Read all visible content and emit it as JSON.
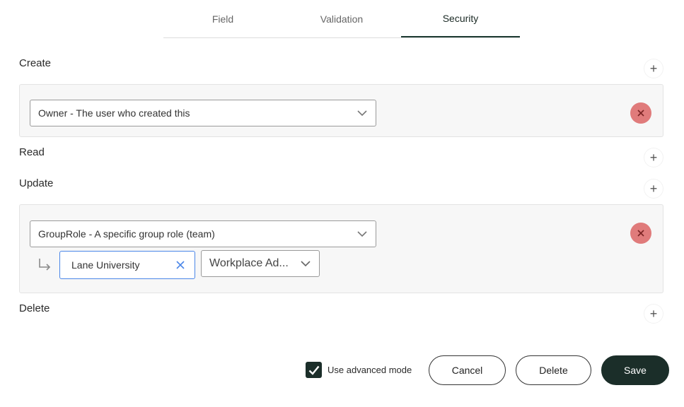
{
  "tabs": [
    {
      "label": "Field",
      "active": false
    },
    {
      "label": "Validation",
      "active": false
    },
    {
      "label": "Security",
      "active": true
    }
  ],
  "sections": {
    "create": {
      "title": "Create",
      "add_icon": "plus-icon",
      "rules": [
        {
          "selected": "Owner - The user who created this",
          "remove_icon": "close-icon"
        }
      ]
    },
    "read": {
      "title": "Read",
      "add_icon": "plus-icon",
      "rules": []
    },
    "update": {
      "title": "Update",
      "add_icon": "plus-icon",
      "rules": [
        {
          "selected": "GroupRole - A specific group role (team)",
          "remove_icon": "close-icon",
          "group_value": "Lane University",
          "role_value": "Workplace Ad..."
        }
      ]
    },
    "delete": {
      "title": "Delete",
      "add_icon": "plus-icon",
      "rules": []
    }
  },
  "footer": {
    "advanced_mode_label": "Use advanced mode",
    "advanced_mode_checked": true,
    "cancel_label": "Cancel",
    "delete_label": "Delete",
    "save_label": "Save"
  },
  "colors": {
    "primary": "#1b2e29",
    "remove": "#e07b7b",
    "focus_border": "#4a86e8"
  }
}
